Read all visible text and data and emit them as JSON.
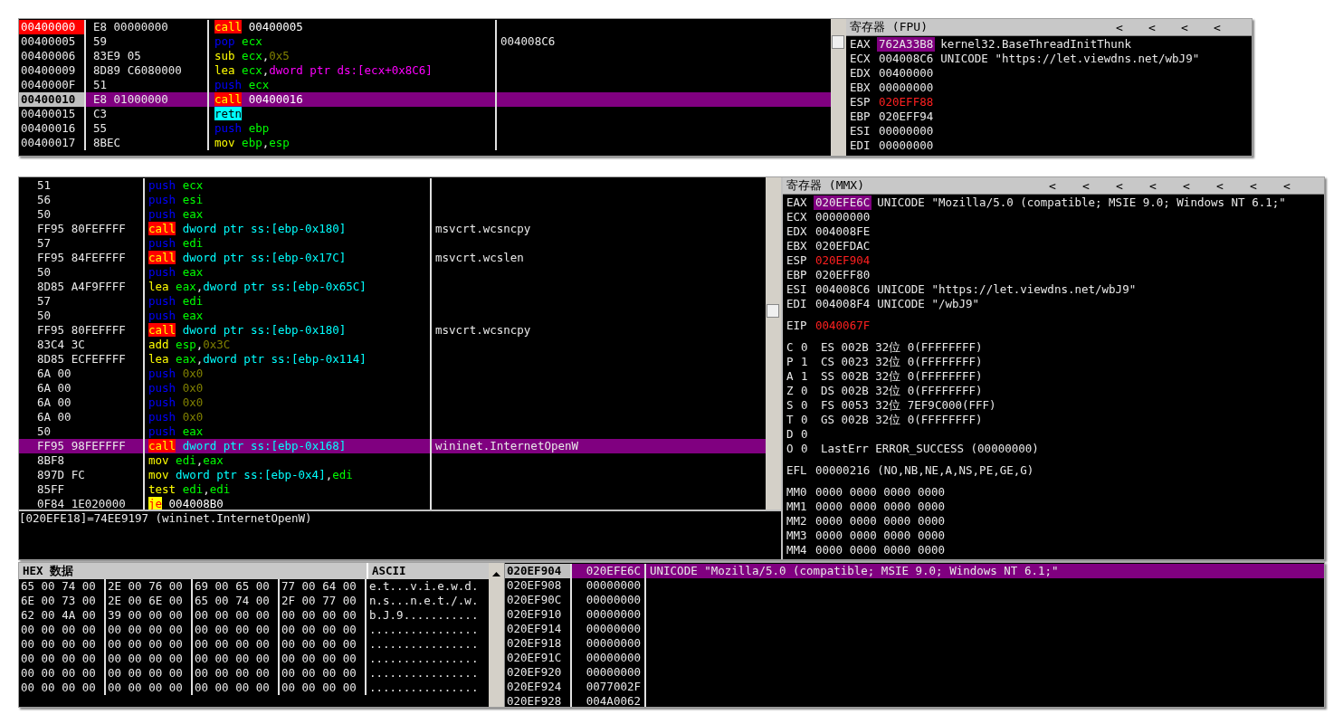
{
  "top_window": {
    "disassembly": [
      {
        "address": "00400000",
        "bytes": "E8 00000000",
        "instruction": [
          {
            "kind": "call",
            "text": "call"
          },
          {
            "kind": "addr",
            "text": "00400005"
          }
        ],
        "eip": true,
        "selected": false
      },
      {
        "address": "00400005",
        "bytes": "59",
        "instruction": [
          {
            "kind": "stack",
            "text": "pop"
          },
          {
            "kind": "reg",
            "text": "ecx"
          }
        ],
        "comment": "004008C6",
        "eip": false,
        "selected": false
      },
      {
        "address": "00400006",
        "bytes": "83E9 05",
        "instruction": [
          {
            "kind": "op",
            "text": "sub"
          },
          {
            "kind": "reg",
            "text": "ecx"
          },
          {
            "kind": "punct",
            "text": ","
          },
          {
            "kind": "imm",
            "text": "0x5"
          }
        ],
        "eip": false,
        "selected": false
      },
      {
        "address": "00400009",
        "bytes": "8D89 C6080000",
        "instruction": [
          {
            "kind": "op",
            "text": "lea"
          },
          {
            "kind": "reg",
            "text": "ecx"
          },
          {
            "kind": "punct",
            "text": ","
          },
          {
            "kind": "mem_ds",
            "text": "dword ptr ds:[ecx+0x8C6]"
          }
        ],
        "eip": false,
        "selected": false
      },
      {
        "address": "0040000F",
        "bytes": "51",
        "instruction": [
          {
            "kind": "stack",
            "text": "push"
          },
          {
            "kind": "reg",
            "text": "ecx"
          }
        ],
        "eip": false,
        "selected": false
      },
      {
        "address": "00400010",
        "bytes": "E8 01000000",
        "instruction": [
          {
            "kind": "call",
            "text": "call"
          },
          {
            "kind": "addr",
            "text": "00400016"
          }
        ],
        "eip": false,
        "selected": true
      },
      {
        "address": "00400015",
        "bytes": "C3",
        "instruction": [
          {
            "kind": "ret",
            "text": "retn"
          }
        ],
        "eip": false,
        "selected": false
      },
      {
        "address": "00400016",
        "bytes": "55",
        "instruction": [
          {
            "kind": "stack",
            "text": "push"
          },
          {
            "kind": "reg",
            "text": "ebp"
          }
        ],
        "eip": false,
        "selected": false
      },
      {
        "address": "00400017",
        "bytes": "8BEC",
        "instruction": [
          {
            "kind": "op",
            "text": "mov"
          },
          {
            "kind": "reg",
            "text": "ebp"
          },
          {
            "kind": "punct",
            "text": ","
          },
          {
            "kind": "reg",
            "text": "esp"
          }
        ],
        "eip": false,
        "selected": false
      }
    ],
    "registers": {
      "title": "寄存器 (FPU)",
      "nav_buttons": [
        "<",
        "<",
        "<",
        "<"
      ],
      "rows": [
        {
          "name": "EAX",
          "value": "762A33B8",
          "comment": "kernel32.BaseThreadInitThunk",
          "highlighted": true,
          "changed": false
        },
        {
          "name": "ECX",
          "value": "004008C6",
          "comment": "UNICODE \"https://let.viewdns.net/wbJ9\"",
          "highlighted": false,
          "changed": false
        },
        {
          "name": "EDX",
          "value": "00400000",
          "highlighted": false,
          "changed": false
        },
        {
          "name": "EBX",
          "value": "00000000",
          "highlighted": false,
          "changed": false
        },
        {
          "name": "ESP",
          "value": "020EFF88",
          "highlighted": false,
          "changed": true
        },
        {
          "name": "EBP",
          "value": "020EFF94",
          "highlighted": false,
          "changed": false
        },
        {
          "name": "ESI",
          "value": "00000000",
          "highlighted": false,
          "changed": false
        },
        {
          "name": "EDI",
          "value": "00000000",
          "highlighted": false,
          "changed": false
        }
      ]
    }
  },
  "middle_window": {
    "disassembly": [
      {
        "bytes": "51",
        "instruction": [
          {
            "kind": "stack",
            "text": "push"
          },
          {
            "kind": "reg",
            "text": "ecx"
          }
        ],
        "selected": false
      },
      {
        "bytes": "56",
        "instruction": [
          {
            "kind": "stack",
            "text": "push"
          },
          {
            "kind": "reg",
            "text": "esi"
          }
        ],
        "selected": false
      },
      {
        "bytes": "50",
        "instruction": [
          {
            "kind": "stack",
            "text": "push"
          },
          {
            "kind": "reg",
            "text": "eax"
          }
        ],
        "selected": false
      },
      {
        "bytes": "FF95 80FEFFFF",
        "instruction": [
          {
            "kind": "call",
            "text": "call"
          },
          {
            "kind": "mem_ss",
            "text": "dword ptr ss:[ebp-0x180]"
          }
        ],
        "comment": "msvcrt.wcsncpy",
        "selected": false
      },
      {
        "bytes": "57",
        "instruction": [
          {
            "kind": "stack",
            "text": "push"
          },
          {
            "kind": "reg",
            "text": "edi"
          }
        ],
        "selected": false
      },
      {
        "bytes": "FF95 84FEFFFF",
        "instruction": [
          {
            "kind": "call",
            "text": "call"
          },
          {
            "kind": "mem_ss",
            "text": "dword ptr ss:[ebp-0x17C]"
          }
        ],
        "comment": "msvcrt.wcslen",
        "selected": false
      },
      {
        "bytes": "50",
        "instruction": [
          {
            "kind": "stack",
            "text": "push"
          },
          {
            "kind": "reg",
            "text": "eax"
          }
        ],
        "selected": false
      },
      {
        "bytes": "8D85 A4F9FFFF",
        "instruction": [
          {
            "kind": "op",
            "text": "lea"
          },
          {
            "kind": "reg",
            "text": "eax"
          },
          {
            "kind": "punct",
            "text": ","
          },
          {
            "kind": "mem_ss",
            "text": "dword ptr ss:[ebp-0x65C]"
          }
        ],
        "selected": false
      },
      {
        "bytes": "57",
        "instruction": [
          {
            "kind": "stack",
            "text": "push"
          },
          {
            "kind": "reg",
            "text": "edi"
          }
        ],
        "selected": false
      },
      {
        "bytes": "50",
        "instruction": [
          {
            "kind": "stack",
            "text": "push"
          },
          {
            "kind": "reg",
            "text": "eax"
          }
        ],
        "selected": false
      },
      {
        "bytes": "FF95 80FEFFFF",
        "instruction": [
          {
            "kind": "call",
            "text": "call"
          },
          {
            "kind": "mem_ss",
            "text": "dword ptr ss:[ebp-0x180]"
          }
        ],
        "comment": "msvcrt.wcsncpy",
        "selected": false
      },
      {
        "bytes": "83C4 3C",
        "instruction": [
          {
            "kind": "op",
            "text": "add"
          },
          {
            "kind": "reg",
            "text": "esp"
          },
          {
            "kind": "punct",
            "text": ","
          },
          {
            "kind": "imm",
            "text": "0x3C"
          }
        ],
        "selected": false
      },
      {
        "bytes": "8D85 ECFEFFFF",
        "instruction": [
          {
            "kind": "op",
            "text": "lea"
          },
          {
            "kind": "reg",
            "text": "eax"
          },
          {
            "kind": "punct",
            "text": ","
          },
          {
            "kind": "mem_ss",
            "text": "dword ptr ss:[ebp-0x114]"
          }
        ],
        "selected": false
      },
      {
        "bytes": "6A 00",
        "instruction": [
          {
            "kind": "stack",
            "text": "push"
          },
          {
            "kind": "imm",
            "text": "0x0"
          }
        ],
        "selected": false
      },
      {
        "bytes": "6A 00",
        "instruction": [
          {
            "kind": "stack",
            "text": "push"
          },
          {
            "kind": "imm",
            "text": "0x0"
          }
        ],
        "selected": false
      },
      {
        "bytes": "6A 00",
        "instruction": [
          {
            "kind": "stack",
            "text": "push"
          },
          {
            "kind": "imm",
            "text": "0x0"
          }
        ],
        "selected": false
      },
      {
        "bytes": "6A 00",
        "instruction": [
          {
            "kind": "stack",
            "text": "push"
          },
          {
            "kind": "imm",
            "text": "0x0"
          }
        ],
        "selected": false
      },
      {
        "bytes": "50",
        "instruction": [
          {
            "kind": "stack",
            "text": "push"
          },
          {
            "kind": "reg",
            "text": "eax"
          }
        ],
        "selected": false
      },
      {
        "bytes": "FF95 98FEFFFF",
        "instruction": [
          {
            "kind": "call",
            "text": "call"
          },
          {
            "kind": "mem_ss",
            "text": "dword ptr ss:[ebp-0x168]"
          }
        ],
        "comment": "wininet.InternetOpenW",
        "selected": true
      },
      {
        "bytes": "8BF8",
        "instruction": [
          {
            "kind": "op",
            "text": "mov"
          },
          {
            "kind": "reg",
            "text": "edi"
          },
          {
            "kind": "punct",
            "text": ","
          },
          {
            "kind": "reg",
            "text": "eax"
          }
        ],
        "selected": false
      },
      {
        "bytes": "897D FC",
        "instruction": [
          {
            "kind": "op",
            "text": "mov"
          },
          {
            "kind": "mem_ss",
            "text": "dword ptr ss:[ebp-0x4]"
          },
          {
            "kind": "punct",
            "text": ","
          },
          {
            "kind": "reg",
            "text": "edi"
          }
        ],
        "selected": false
      },
      {
        "bytes": "85FF",
        "instruction": [
          {
            "kind": "op",
            "text": "test"
          },
          {
            "kind": "reg",
            "text": "edi"
          },
          {
            "kind": "punct",
            "text": ","
          },
          {
            "kind": "reg",
            "text": "edi"
          }
        ],
        "selected": false
      },
      {
        "bytes": "0F84 1E020000",
        "instruction": [
          {
            "kind": "jump",
            "text": "je"
          },
          {
            "kind": "addr",
            "text": "004008B0"
          }
        ],
        "selected": false
      }
    ],
    "info_line": "[020EFE18]=74EE9197 (wininet.InternetOpenW)",
    "registers": {
      "title": "寄存器 (MMX)",
      "nav_buttons": [
        "<",
        "<",
        "<",
        "<",
        "<",
        "<",
        "<",
        "<"
      ],
      "general": [
        {
          "name": "EAX",
          "value": "020EFE6C",
          "comment": "UNICODE \"Mozilla/5.0 (compatible; MSIE 9.0; Windows NT 6.1;\"",
          "highlighted": true,
          "changed": false
        },
        {
          "name": "ECX",
          "value": "00000000",
          "highlighted": false,
          "changed": false
        },
        {
          "name": "EDX",
          "value": "004008FE",
          "highlighted": false,
          "changed": false
        },
        {
          "name": "EBX",
          "value": "020EFDAC",
          "highlighted": false,
          "changed": false
        },
        {
          "name": "ESP",
          "value": "020EF904",
          "highlighted": false,
          "changed": true
        },
        {
          "name": "EBP",
          "value": "020EFF80",
          "highlighted": false,
          "changed": false
        },
        {
          "name": "ESI",
          "value": "004008C6",
          "comment": "UNICODE \"https://let.viewdns.net/wbJ9\"",
          "highlighted": false,
          "changed": false
        },
        {
          "name": "EDI",
          "value": "004008F4",
          "comment": "UNICODE \"/wbJ9\"",
          "highlighted": false,
          "changed": false
        }
      ],
      "eip": [
        {
          "name": "EIP",
          "value": "0040067F",
          "highlighted": false,
          "changed": true
        }
      ],
      "flags": [
        {
          "flag": "C",
          "value": "0",
          "detail": "ES 002B 32位 0(FFFFFFFF)"
        },
        {
          "flag": "P",
          "value": "1",
          "detail": "CS 0023 32位 0(FFFFFFFF)"
        },
        {
          "flag": "A",
          "value": "1",
          "detail": "SS 002B 32位 0(FFFFFFFF)"
        },
        {
          "flag": "Z",
          "value": "0",
          "detail": "DS 002B 32位 0(FFFFFFFF)"
        },
        {
          "flag": "S",
          "value": "0",
          "detail": "FS 0053 32位 7EF9C000(FFF)"
        },
        {
          "flag": "T",
          "value": "0",
          "detail": "GS 002B 32位 0(FFFFFFFF)"
        },
        {
          "flag": "D",
          "value": "0"
        },
        {
          "flag": "O",
          "value": "0",
          "detail": "LastErr ERROR_SUCCESS (00000000)"
        }
      ],
      "efl": [
        {
          "name": "EFL",
          "value": "00000216",
          "comment": "(NO,NB,NE,A,NS,PE,GE,G)",
          "highlighted": false,
          "changed": false
        }
      ],
      "mmx": [
        {
          "name": "MM0",
          "value": "0000 0000 0000 0000",
          "highlighted": false,
          "changed": false
        },
        {
          "name": "MM1",
          "value": "0000 0000 0000 0000",
          "highlighted": false,
          "changed": false
        },
        {
          "name": "MM2",
          "value": "0000 0000 0000 0000",
          "highlighted": false,
          "changed": false
        },
        {
          "name": "MM3",
          "value": "0000 0000 0000 0000",
          "highlighted": false,
          "changed": false
        },
        {
          "name": "MM4",
          "value": "0000 0000 0000 0000",
          "highlighted": false,
          "changed": false
        }
      ]
    }
  },
  "bottom_window": {
    "hex_dump": {
      "columns": [
        "HEX 数据",
        "ASCII"
      ],
      "rows": [
        {
          "groups": [
            "65 00 74 00",
            "2E 00 76 00",
            "69 00 65 00",
            "77 00 64 00"
          ],
          "ascii": "e.t...v.i.e.w.d."
        },
        {
          "groups": [
            "6E 00 73 00",
            "2E 00 6E 00",
            "65 00 74 00",
            "2F 00 77 00"
          ],
          "ascii": "n.s...n.e.t./.w."
        },
        {
          "groups": [
            "62 00 4A 00",
            "39 00 00 00",
            "00 00 00 00",
            "00 00 00 00"
          ],
          "ascii": "b.J.9..........."
        },
        {
          "groups": [
            "00 00 00 00",
            "00 00 00 00",
            "00 00 00 00",
            "00 00 00 00"
          ],
          "ascii": "................"
        },
        {
          "groups": [
            "00 00 00 00",
            "00 00 00 00",
            "00 00 00 00",
            "00 00 00 00"
          ],
          "ascii": "................"
        },
        {
          "groups": [
            "00 00 00 00",
            "00 00 00 00",
            "00 00 00 00",
            "00 00 00 00"
          ],
          "ascii": "................"
        },
        {
          "groups": [
            "00 00 00 00",
            "00 00 00 00",
            "00 00 00 00",
            "00 00 00 00"
          ],
          "ascii": "................"
        },
        {
          "groups": [
            "00 00 00 00",
            "00 00 00 00",
            "00 00 00 00",
            "00 00 00 00"
          ],
          "ascii": "................"
        }
      ]
    },
    "stack": [
      {
        "address": "020EF904",
        "value": "020EFE6C",
        "comment": "UNICODE \"Mozilla/5.0 (compatible; MSIE 9.0; Windows NT 6.1;\"",
        "selected": true
      },
      {
        "address": "020EF908",
        "value": "00000000",
        "selected": false
      },
      {
        "address": "020EF90C",
        "value": "00000000",
        "selected": false
      },
      {
        "address": "020EF910",
        "value": "00000000",
        "selected": false
      },
      {
        "address": "020EF914",
        "value": "00000000",
        "selected": false
      },
      {
        "address": "020EF918",
        "value": "00000000",
        "selected": false
      },
      {
        "address": "020EF91C",
        "value": "00000000",
        "selected": false
      },
      {
        "address": "020EF920",
        "value": "00000000",
        "selected": false
      },
      {
        "address": "020EF924",
        "value": "0077002F",
        "selected": false
      },
      {
        "address": "020EF928",
        "value": "004A0062",
        "selected": false
      }
    ]
  }
}
